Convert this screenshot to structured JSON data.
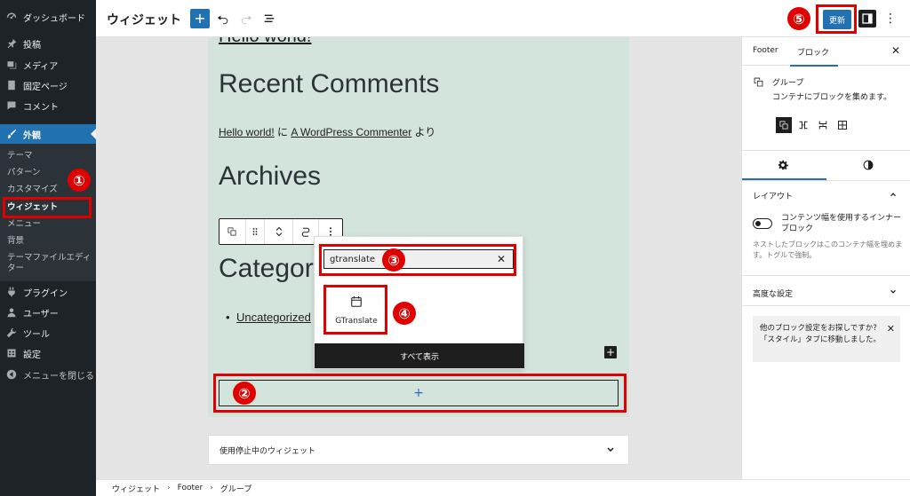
{
  "sidebar": {
    "dashboard": "ダッシュボード",
    "posts": "投稿",
    "media": "メディア",
    "pages": "固定ページ",
    "comments": "コメント",
    "appearance": "外観",
    "sub": {
      "themes": "テーマ",
      "patterns": "パターン",
      "customize": "カスタマイズ",
      "widgets": "ウィジェット",
      "menus": "メニュー",
      "background": "背景",
      "theme_editor": "テーマファイルエディター"
    },
    "plugins": "プラグイン",
    "users": "ユーザー",
    "tools": "ツール",
    "settings": "設定",
    "collapse": "メニューを閉じる"
  },
  "toolbar": {
    "title": "ウィジェット",
    "add": "+",
    "update_label": "更新",
    "more": "⋮"
  },
  "canvas": {
    "hello_world_top": "Hello world!",
    "recent_comments": "Recent Comments",
    "comment_link1": "Hello world!",
    "comment_mid": " に ",
    "comment_link2": "A WordPress Commenter",
    "comment_end": " より",
    "archives": "Archives",
    "categories_partial": "Categor",
    "uncategorized_partial": "Uncategorized",
    "inserter_plus": "+",
    "black_plus": "+",
    "inactive_widgets": "使用停止中のウィジェット"
  },
  "inserter": {
    "search_value": "gtranslate",
    "clear": "✕",
    "result_label": "GTranslate",
    "show_all": "すべて表示"
  },
  "breadcrumb": {
    "items": [
      "ウィジェット",
      "Footer",
      "グループ"
    ],
    "sep": "›"
  },
  "settings_panel": {
    "tab_footer": "Footer",
    "tab_block": "ブロック",
    "close": "✕",
    "block_name": "グループ",
    "block_desc": "コンテナにブロックを集めます。",
    "layout_heading": "レイアウト",
    "toggle_label": "コンテンツ幅を使用するインナーブロック",
    "help_text": "ネストしたブロックはこのコンテナ幅を埋めます。トグルで強制。",
    "advanced_heading": "高度な設定",
    "notice_text": "他のブロック設定をお探しですか?「スタイル」タブに移動しました。",
    "notice_close": "✕"
  },
  "annotations": [
    "①",
    "②",
    "③",
    "④",
    "⑤"
  ],
  "colors": {
    "accent": "#2271b1",
    "annotation_red": "#e00000",
    "sidebar_bg": "#1d2327",
    "widget_bg": "#d2e4dc"
  }
}
